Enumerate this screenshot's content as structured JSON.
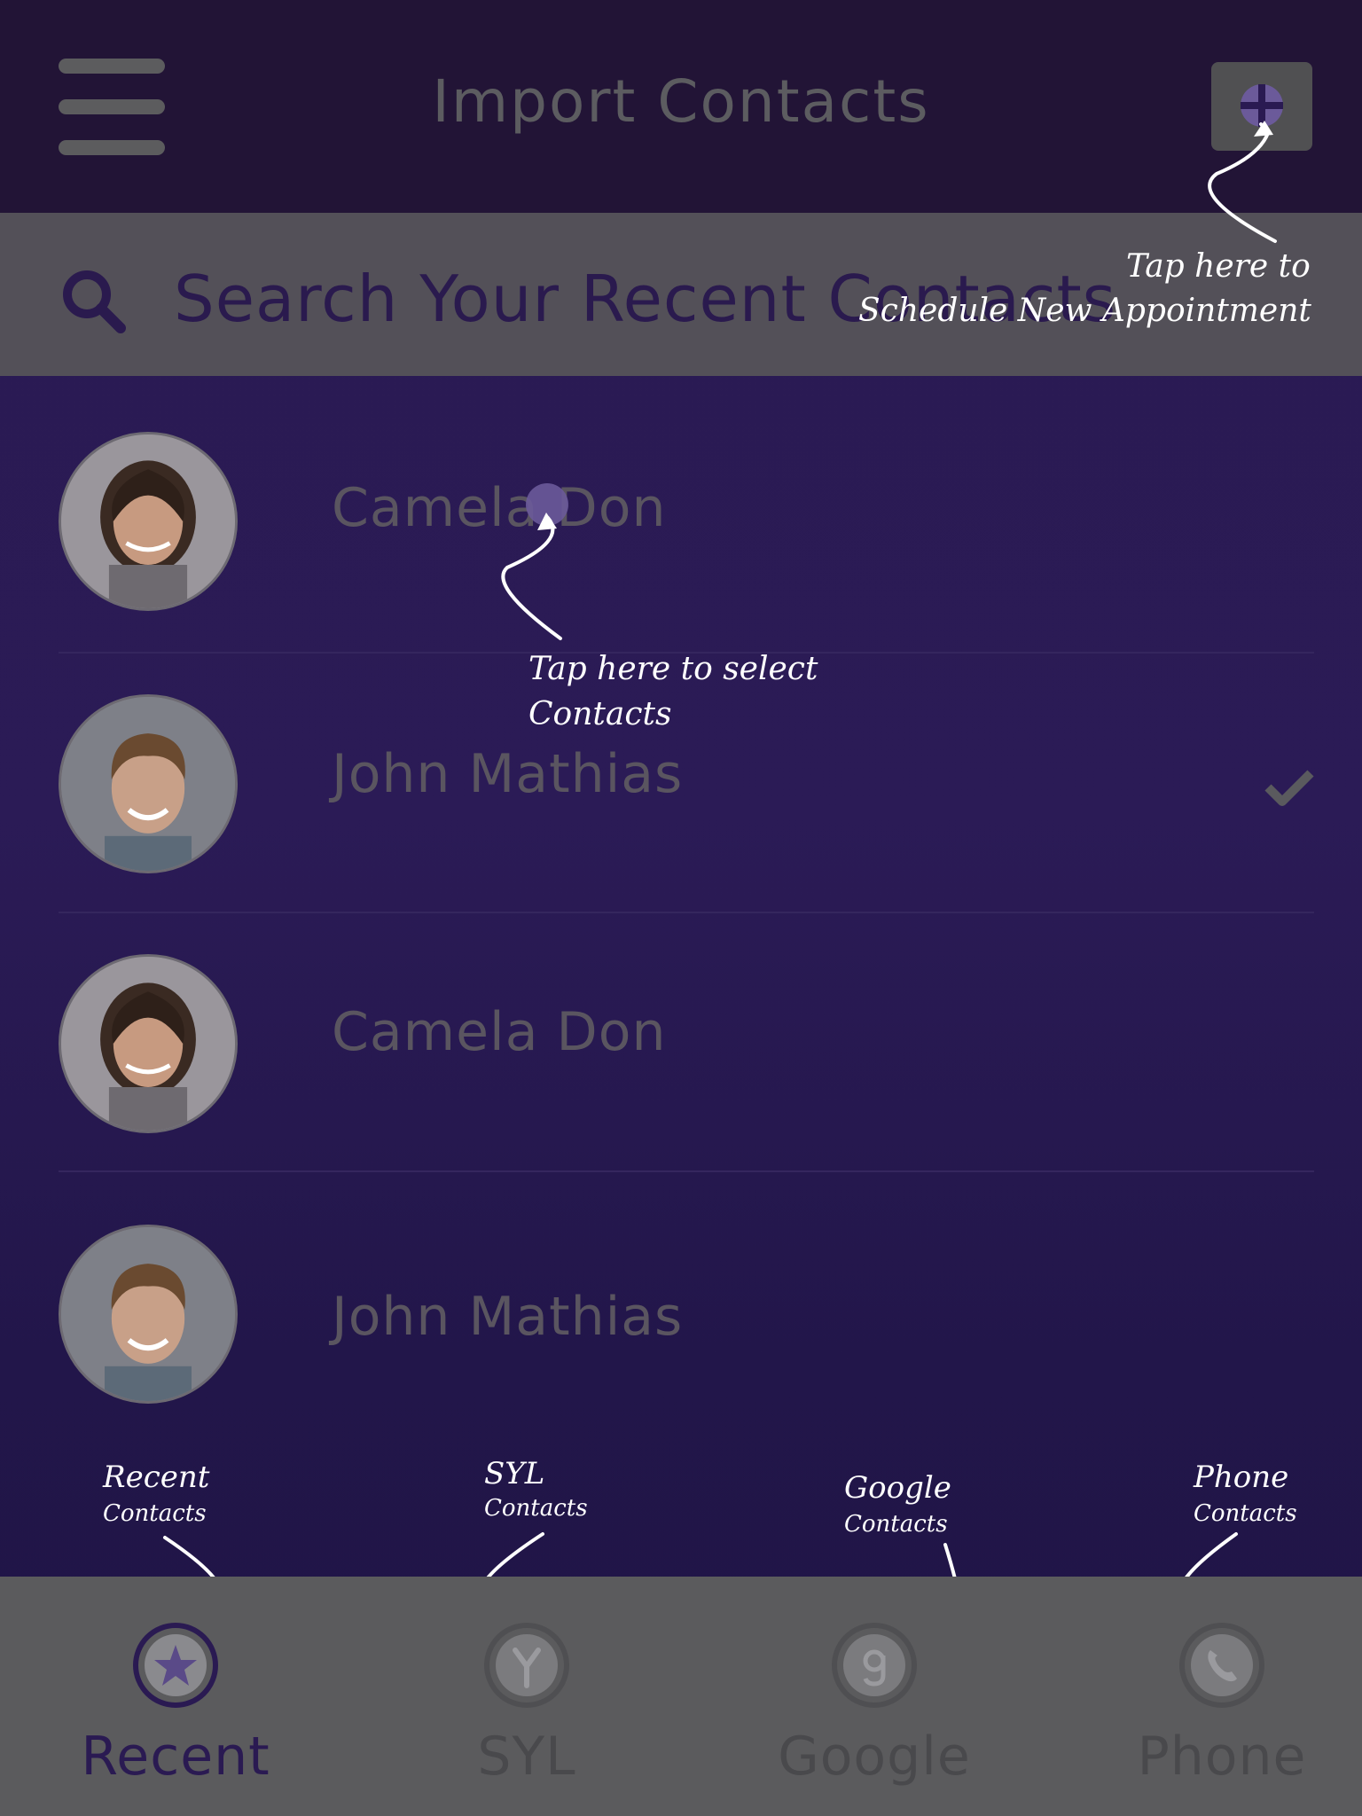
{
  "header": {
    "title": "Import Contacts"
  },
  "search": {
    "placeholder": "Search Your Recent Contacts"
  },
  "contacts": [
    {
      "name": "Camela Don",
      "selected": false
    },
    {
      "name": "John Mathias",
      "selected": true
    },
    {
      "name": "Camela Don",
      "selected": false
    },
    {
      "name": "John Mathias",
      "selected": false
    }
  ],
  "annotations": {
    "schedule_line1": "Tap here to",
    "schedule_line2": "Schedule New Appointment",
    "select_line1": "Tap here to select",
    "select_line2": "Contacts",
    "recent_title": "Recent",
    "recent_sub": "Contacts",
    "syl_title": "SYL",
    "syl_sub": "Contacts",
    "google_title": "Google",
    "google_sub": "Contacts",
    "phone_title": "Phone",
    "phone_sub": "Contacts"
  },
  "tabs": [
    {
      "label": "Recent",
      "icon": "star-icon",
      "active": true
    },
    {
      "label": "SYL",
      "icon": "syl-logo-icon",
      "active": false
    },
    {
      "label": "Google",
      "icon": "google-icon",
      "active": false
    },
    {
      "label": "Phone",
      "icon": "phone-icon",
      "active": false
    }
  ],
  "colors": {
    "background": "#2a1a52",
    "header": "#221436",
    "search_bar": "#535058",
    "tab_bar": "#5b5b5d",
    "annotation": "#ffffff"
  }
}
